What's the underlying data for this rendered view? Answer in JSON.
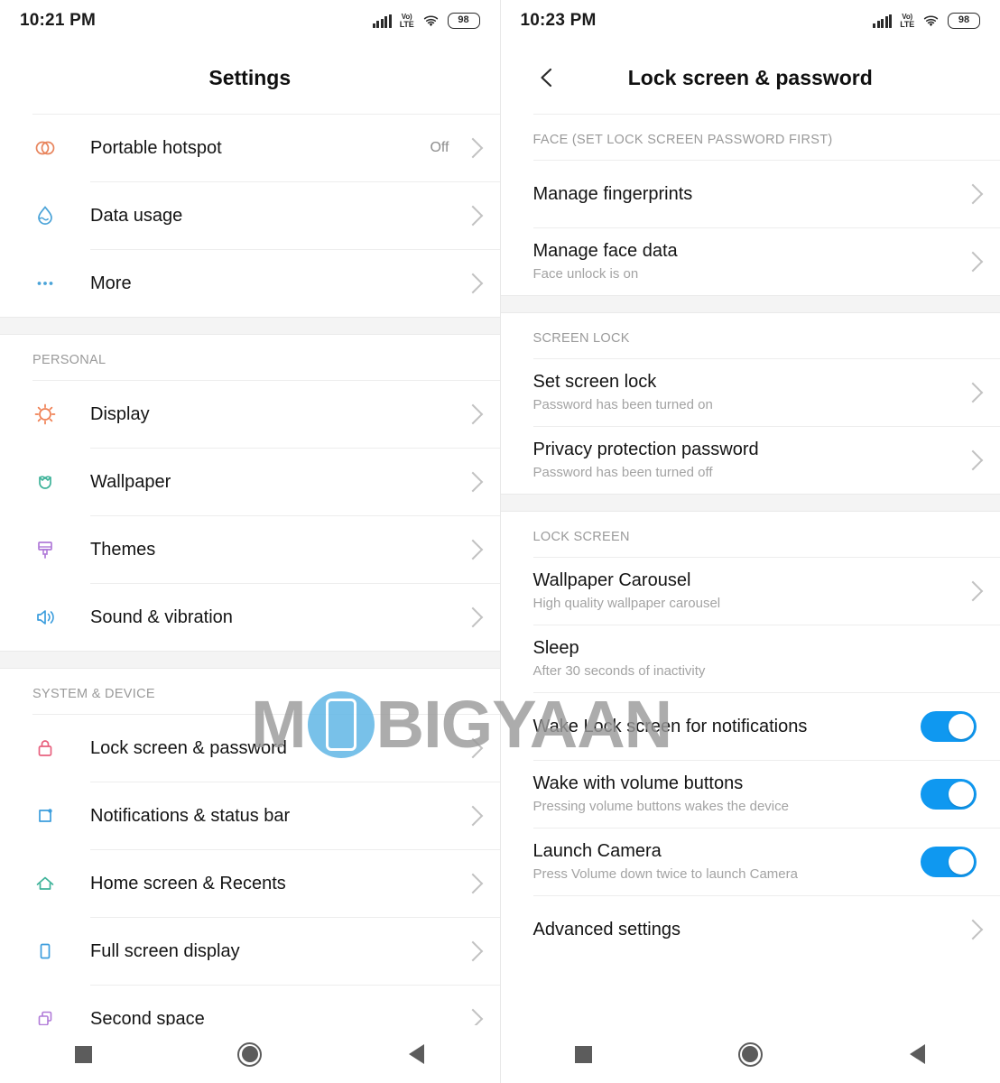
{
  "left_screen": {
    "status_bar": {
      "time": "10:21 PM",
      "battery_level": "98",
      "network_label_top": "Vo)",
      "network_label_bottom": "LTE",
      "icons": [
        "signal-icon",
        "volte-icon",
        "wifi-icon",
        "battery-icon"
      ]
    },
    "title": "Settings",
    "groups": [
      {
        "header": "",
        "items": [
          {
            "label": "Portable hotspot",
            "sub": "",
            "value": "Off",
            "icon": "hotspot-icon",
            "icon_color": "#e8845c",
            "chevron": true
          },
          {
            "label": "Data usage",
            "sub": "",
            "value": "",
            "icon": "data-usage-icon",
            "icon_color": "#4aa3d8",
            "chevron": true
          },
          {
            "label": "More",
            "sub": "",
            "value": "",
            "icon": "more-dots-icon",
            "icon_color": "#4aa3d8",
            "chevron": true
          }
        ]
      },
      {
        "header": "PERSONAL",
        "items": [
          {
            "label": "Display",
            "sub": "",
            "value": "",
            "icon": "brightness-sun-icon",
            "icon_color": "#ef8054",
            "chevron": true
          },
          {
            "label": "Wallpaper",
            "sub": "",
            "value": "",
            "icon": "tulip-flower-icon",
            "icon_color": "#3fb39a",
            "chevron": true
          },
          {
            "label": "Themes",
            "sub": "",
            "value": "",
            "icon": "paint-brush-icon",
            "icon_color": "#b07ad8",
            "chevron": true
          },
          {
            "label": "Sound & vibration",
            "sub": "",
            "value": "",
            "icon": "speaker-volume-icon",
            "icon_color": "#3b9ddd",
            "chevron": true
          }
        ]
      },
      {
        "header": "SYSTEM & DEVICE",
        "items": [
          {
            "label": "Lock screen & password",
            "sub": "",
            "value": "",
            "icon": "lock-icon",
            "icon_color": "#e8607e",
            "chevron": true
          },
          {
            "label": "Notifications & status bar",
            "sub": "",
            "value": "",
            "icon": "notification-badge-icon",
            "icon_color": "#3b9ddd",
            "chevron": true
          },
          {
            "label": "Home screen & Recents",
            "sub": "",
            "value": "",
            "icon": "home-house-icon",
            "icon_color": "#3fb39a",
            "chevron": true
          },
          {
            "label": "Full screen display",
            "sub": "",
            "value": "",
            "icon": "phone-screen-icon",
            "icon_color": "#3b9ddd",
            "chevron": true
          },
          {
            "label": "Second space",
            "sub": "",
            "value": "",
            "icon": "second-space-icon",
            "icon_color": "#b07ad8",
            "chevron": true
          }
        ]
      }
    ]
  },
  "right_screen": {
    "status_bar": {
      "time": "10:23 PM",
      "battery_level": "98",
      "network_label_top": "Vo)",
      "network_label_bottom": "LTE",
      "icons": [
        "signal-icon",
        "volte-icon",
        "wifi-icon",
        "battery-icon"
      ]
    },
    "title": "Lock screen & password",
    "back_icon": "back-chevron-icon",
    "groups": [
      {
        "header": "FACE (SET LOCK SCREEN PASSWORD FIRST)",
        "items": [
          {
            "label": "Manage fingerprints",
            "sub": "",
            "control": "chevron"
          },
          {
            "label": "Manage face data",
            "sub": "Face unlock is on",
            "control": "chevron"
          }
        ]
      },
      {
        "header": "SCREEN LOCK",
        "items": [
          {
            "label": "Set screen lock",
            "sub": "Password has been turned on",
            "control": "chevron"
          },
          {
            "label": "Privacy protection password",
            "sub": "Password has been turned off",
            "control": "chevron"
          }
        ]
      },
      {
        "header": "LOCK SCREEN",
        "items": [
          {
            "label": "Wallpaper Carousel",
            "sub": "High quality wallpaper carousel",
            "control": "chevron"
          },
          {
            "label": "Sleep",
            "sub": "After 30 seconds of inactivity",
            "control": "none"
          },
          {
            "label": "Wake Lock screen for notifications",
            "sub": "",
            "control": "toggle",
            "toggle_on": true
          },
          {
            "label": "Wake with volume buttons",
            "sub": "Pressing volume buttons wakes the device",
            "control": "toggle",
            "toggle_on": true
          },
          {
            "label": "Launch Camera",
            "sub": "Press Volume down twice to launch Camera",
            "control": "toggle",
            "toggle_on": true
          },
          {
            "label": "Advanced settings",
            "sub": "",
            "control": "chevron"
          }
        ]
      }
    ]
  },
  "nav_bar": {
    "buttons": [
      {
        "name": "recents-button",
        "icon": "square-icon"
      },
      {
        "name": "home-button",
        "icon": "circle-icon"
      },
      {
        "name": "back-button",
        "icon": "triangle-left-icon"
      }
    ]
  },
  "watermark": {
    "text_before": "M",
    "text_after": "BIGYAAN",
    "logo_icon": "mobigyaan-phone-logo",
    "color": "#9a9a9a",
    "accent_color": "#5bb4e5"
  },
  "theme": {
    "toggle_on_color": "#0f98f0",
    "divider_color": "#ededed",
    "section_label_color": "#9a9a9a",
    "primary_text_color": "#141414",
    "secondary_text_color": "#a3a3a3"
  }
}
